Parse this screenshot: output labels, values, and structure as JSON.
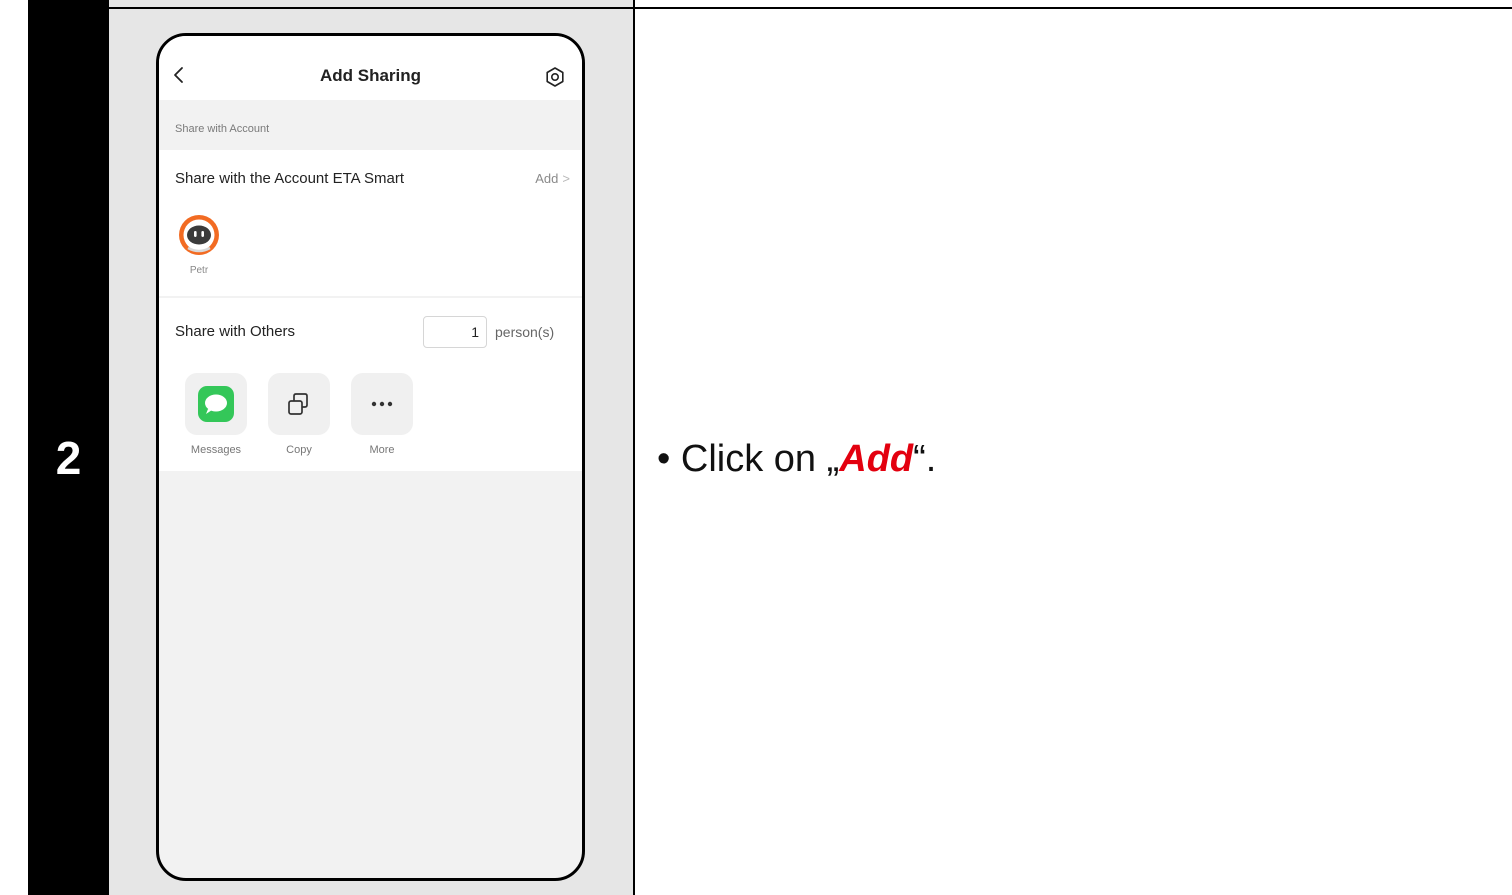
{
  "step": {
    "number": "2"
  },
  "instruction": {
    "bullet": "•",
    "prefix": "Click on „",
    "highlight": "Add",
    "suffix": "“."
  },
  "phone": {
    "title": "Add Sharing",
    "icons": {
      "back": "chevron-left-icon",
      "settings": "settings-ring-icon"
    },
    "share_with_account": {
      "section_label": "Share with Account",
      "title": "Share with the Account ETA Smart",
      "add_label": "Add",
      "add_chevron": ">",
      "member": {
        "name": "Petr",
        "avatar": "robot-avatar-icon"
      }
    },
    "share_with_others": {
      "title": "Share with Others",
      "count": "1",
      "count_unit": "person(s)",
      "options": [
        {
          "label": "Messages",
          "icon": "messages-icon"
        },
        {
          "label": "Copy",
          "icon": "copy-icon"
        },
        {
          "label": "More",
          "icon": "more-dots-icon"
        }
      ]
    }
  },
  "colors": {
    "step_column": "#000000",
    "screen_column": "#e6e6e6",
    "highlight": "#e3000f",
    "messages_green": "#34c759",
    "avatar_orange": "#f26b22"
  }
}
